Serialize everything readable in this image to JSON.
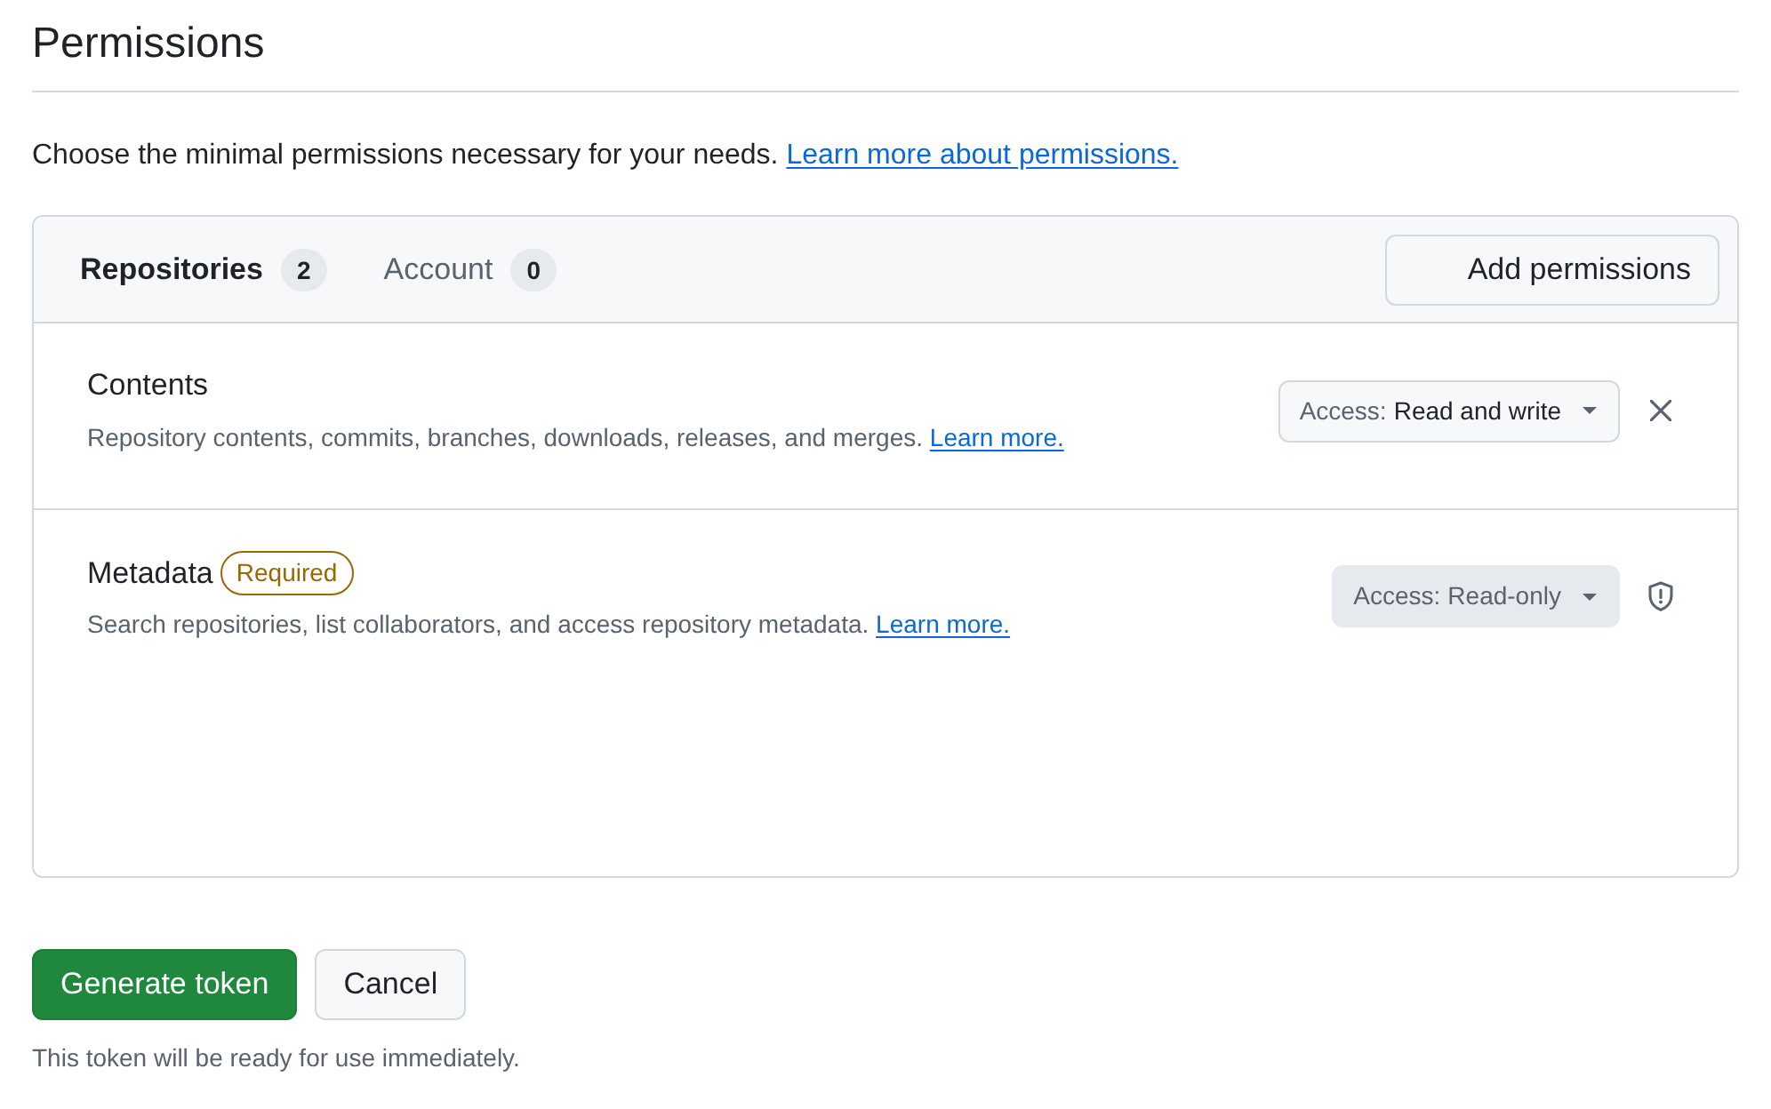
{
  "heading": "Permissions",
  "intro": {
    "text": "Choose the minimal permissions necessary for your needs.",
    "link": "Learn more about permissions."
  },
  "tabs": [
    {
      "label": "Repositories",
      "count": "2",
      "selected": true
    },
    {
      "label": "Account",
      "count": "0",
      "selected": false
    }
  ],
  "add_button": "Add permissions",
  "permissions": [
    {
      "name": "Contents",
      "description": "Repository contents, commits, branches, downloads, releases, and merges.",
      "link": "Learn more.",
      "access_label": "Access:",
      "access_value": "Read and write",
      "disabled": false,
      "kind": "removable"
    },
    {
      "name": "Metadata",
      "badge": "Required",
      "description": "Search repositories, list collaborators, and access repository metadata.",
      "link": "Learn more.",
      "access_label": "Access:",
      "access_value": "Read-only",
      "disabled": true,
      "kind": "locked"
    }
  ],
  "actions": [
    {
      "label": "Generate token",
      "kind": "primary"
    },
    {
      "label": "Cancel",
      "kind": "secondary"
    }
  ],
  "note": "This token will be ready for use immediately."
}
